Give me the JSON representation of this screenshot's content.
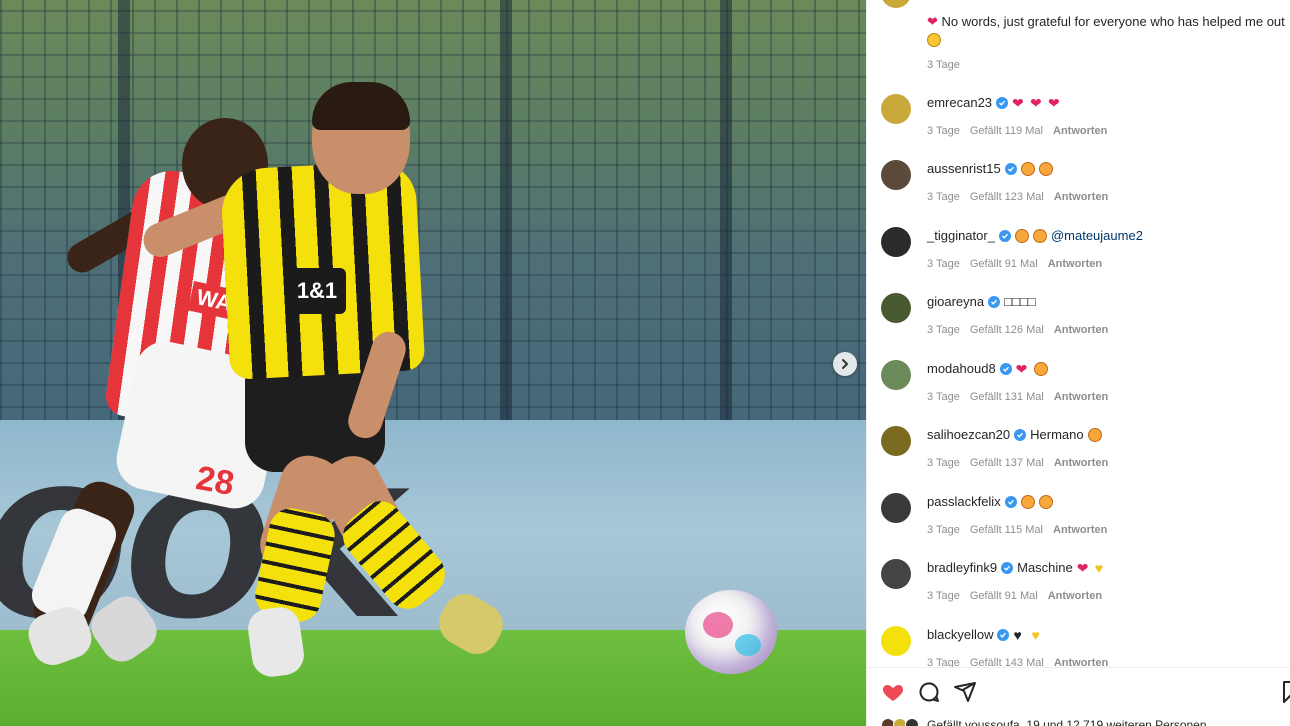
{
  "photo": {
    "board_text": "OOK",
    "shirt_sponsor": "1&1",
    "player_number": "28",
    "opponent_tag": "WAYLA"
  },
  "caption": {
    "text": "No words, just grateful for everyone who has helped me out",
    "time": "3 Tage"
  },
  "comments": [
    {
      "user": "emrecan23",
      "text": "",
      "emojis": [
        "heart",
        "heart",
        "heart"
      ],
      "time": "3 Tage",
      "likes": "Gefällt 119 Mal",
      "reply": "Antworten"
    },
    {
      "user": "aussenrist15",
      "text": "",
      "emojis": [
        "face",
        "face"
      ],
      "time": "3 Tage",
      "likes": "Gefällt 123 Mal",
      "reply": "Antworten"
    },
    {
      "user": "_tigginator_",
      "text": "",
      "mention": "@mateujaume2",
      "emojis": [
        "face",
        "face"
      ],
      "time": "3 Tage",
      "likes": "Gefällt 91 Mal",
      "reply": "Antworten"
    },
    {
      "user": "gioareyna",
      "text": "□□□□",
      "emojis": [],
      "time": "3 Tage",
      "likes": "Gefällt 126 Mal",
      "reply": "Antworten"
    },
    {
      "user": "modahoud8",
      "text": "",
      "emojis": [
        "heart",
        "face"
      ],
      "time": "3 Tage",
      "likes": "Gefällt 131 Mal",
      "reply": "Antworten"
    },
    {
      "user": "salihoezcan20",
      "text": "Hermano",
      "emojis": [
        "face"
      ],
      "time": "3 Tage",
      "likes": "Gefällt 137 Mal",
      "reply": "Antworten"
    },
    {
      "user": "passlackfelix",
      "text": "",
      "emojis": [
        "face",
        "face"
      ],
      "time": "3 Tage",
      "likes": "Gefällt 115 Mal",
      "reply": "Antworten"
    },
    {
      "user": "bradleyfink9",
      "text": "Maschine",
      "emojis": [
        "heart",
        "yellow"
      ],
      "time": "3 Tage",
      "likes": "Gefällt 91 Mal",
      "reply": "Antworten"
    },
    {
      "user": "blackyellow",
      "text": "",
      "emojis": [
        "black",
        "yellow"
      ],
      "time": "3 Tage",
      "likes": "Gefällt 143 Mal",
      "reply": "Antworten"
    }
  ],
  "avatars": [
    "#c9a93a",
    "#5c4a3a",
    "#2b2b2b",
    "#4a5a30",
    "#6a8a5a",
    "#7a6a20",
    "#3a3a3a",
    "#444",
    "#f4e00a"
  ],
  "footer": {
    "likes_text": "Gefällt youssoufa_19 und 12.719 weiteren Personen"
  },
  "colors": {
    "accent_heart": "#ed4956",
    "verified": "#3897f0",
    "muted": "#8e8e8e"
  }
}
